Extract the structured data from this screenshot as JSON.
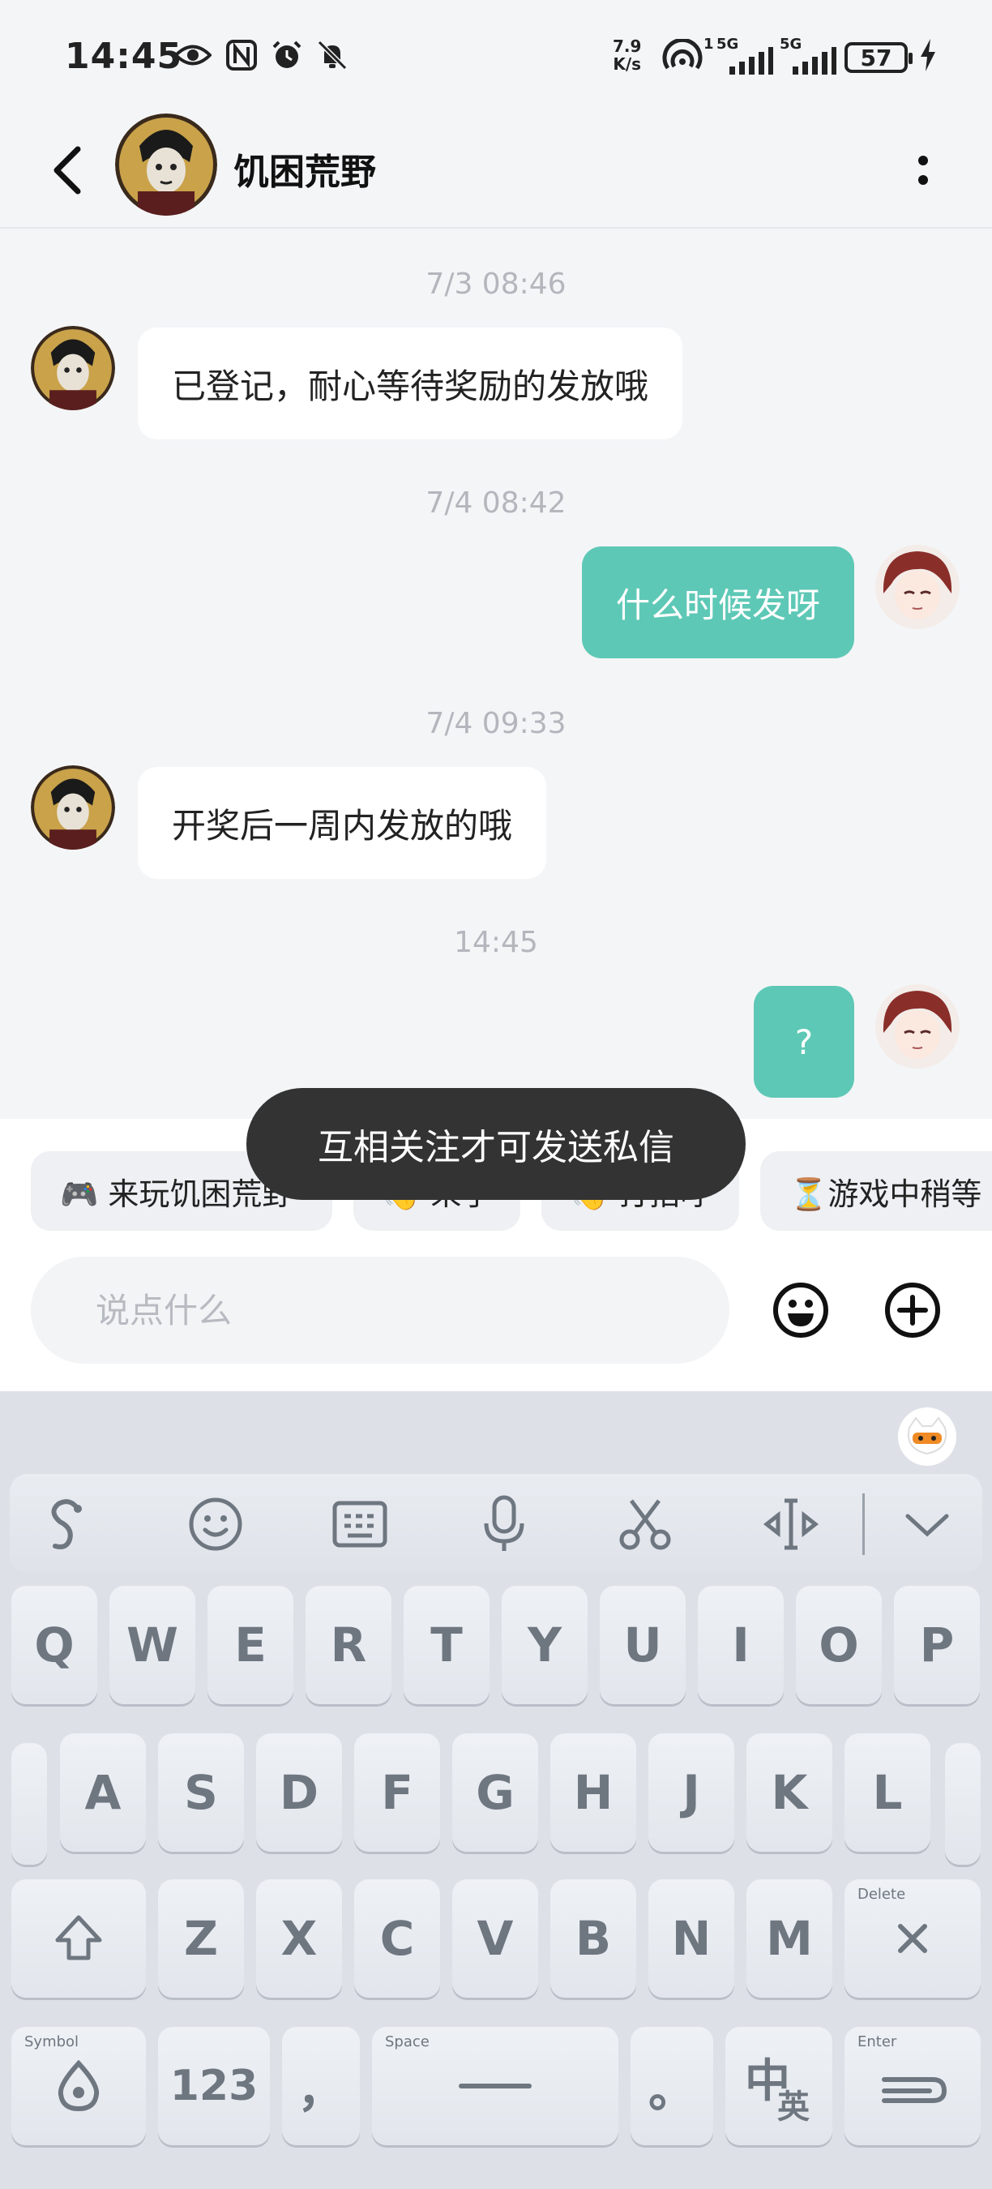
{
  "status_bar": {
    "time": "14:45",
    "net_speed_value": "7.9",
    "net_speed_unit": "K/s",
    "signal_1_label": "5G",
    "signal_2_label": "5G",
    "battery": "57",
    "icons": [
      "eye-icon",
      "nfc-icon",
      "alarm-icon",
      "mute-icon",
      "hotspot-icon",
      "signal-icon",
      "charging-icon"
    ]
  },
  "header": {
    "title": "饥困荒野"
  },
  "messages": [
    {
      "timestamp": "7/3  08:46",
      "direction": "in",
      "text": "已登记，耐心等待奖励的发放哦"
    },
    {
      "timestamp": "7/4  08:42",
      "direction": "out",
      "text": "什么时候发呀"
    },
    {
      "timestamp": "7/4  09:33",
      "direction": "in",
      "text": "开奖后一周内发放的哦"
    },
    {
      "timestamp": "14:45",
      "direction": "out",
      "text": "?"
    }
  ],
  "toast": "互相关注才可发送私信",
  "quick_replies": [
    "🎮 来玩饥困荒野",
    "👋 来了",
    "👋 打招呼",
    "⏳游戏中稍等"
  ],
  "composer": {
    "placeholder": "说点什么"
  },
  "keyboard": {
    "row1": [
      "Q",
      "W",
      "E",
      "R",
      "T",
      "Y",
      "U",
      "I",
      "O",
      "P"
    ],
    "row2": [
      "A",
      "S",
      "D",
      "F",
      "G",
      "H",
      "J",
      "K",
      "L"
    ],
    "row3": [
      "Z",
      "X",
      "C",
      "V",
      "B",
      "N",
      "M"
    ],
    "delete_hint": "Delete",
    "symbol_hint": "Symbol",
    "num_label": "123",
    "comma": "，",
    "space_hint": "Space",
    "period": "。",
    "lang_label_main": "中",
    "lang_label_sub": "英",
    "enter_hint": "Enter"
  },
  "colors": {
    "outgoing_bubble": "#5ec8b6",
    "background": "#f4f5f7",
    "toast": "#333333",
    "keyboard": "#dde1e7"
  }
}
